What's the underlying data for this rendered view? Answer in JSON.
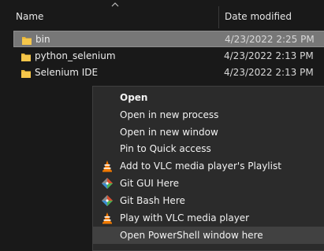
{
  "columns": {
    "name": "Name",
    "date_modified": "Date modified"
  },
  "files": [
    {
      "name": "bin",
      "date": "4/23/2022 2:25 PM",
      "selected": true
    },
    {
      "name": "python_selenium",
      "date": "4/23/2022 2:13 PM",
      "selected": false
    },
    {
      "name": "Selenium IDE",
      "date": "4/23/2022 2:13 PM",
      "selected": false
    }
  ],
  "context_menu": {
    "items": [
      {
        "label": "Open",
        "icon": null
      },
      {
        "label": "Open in new process",
        "icon": null
      },
      {
        "label": "Open in new window",
        "icon": null
      },
      {
        "label": "Pin to Quick access",
        "icon": null
      },
      {
        "label": "Add to VLC media player's Playlist",
        "icon": "vlc-icon"
      },
      {
        "label": "Git GUI Here",
        "icon": "git-gui-icon"
      },
      {
        "label": "Git Bash Here",
        "icon": "git-bash-icon"
      },
      {
        "label": "Play with VLC media player",
        "icon": "vlc-icon"
      },
      {
        "label": "Open PowerShell window here",
        "icon": null
      }
    ]
  },
  "colors": {
    "folder": "#e8b637",
    "vlc_orange": "#f27a00",
    "selection": "#777777",
    "menu_bg": "#2b2b2b"
  }
}
